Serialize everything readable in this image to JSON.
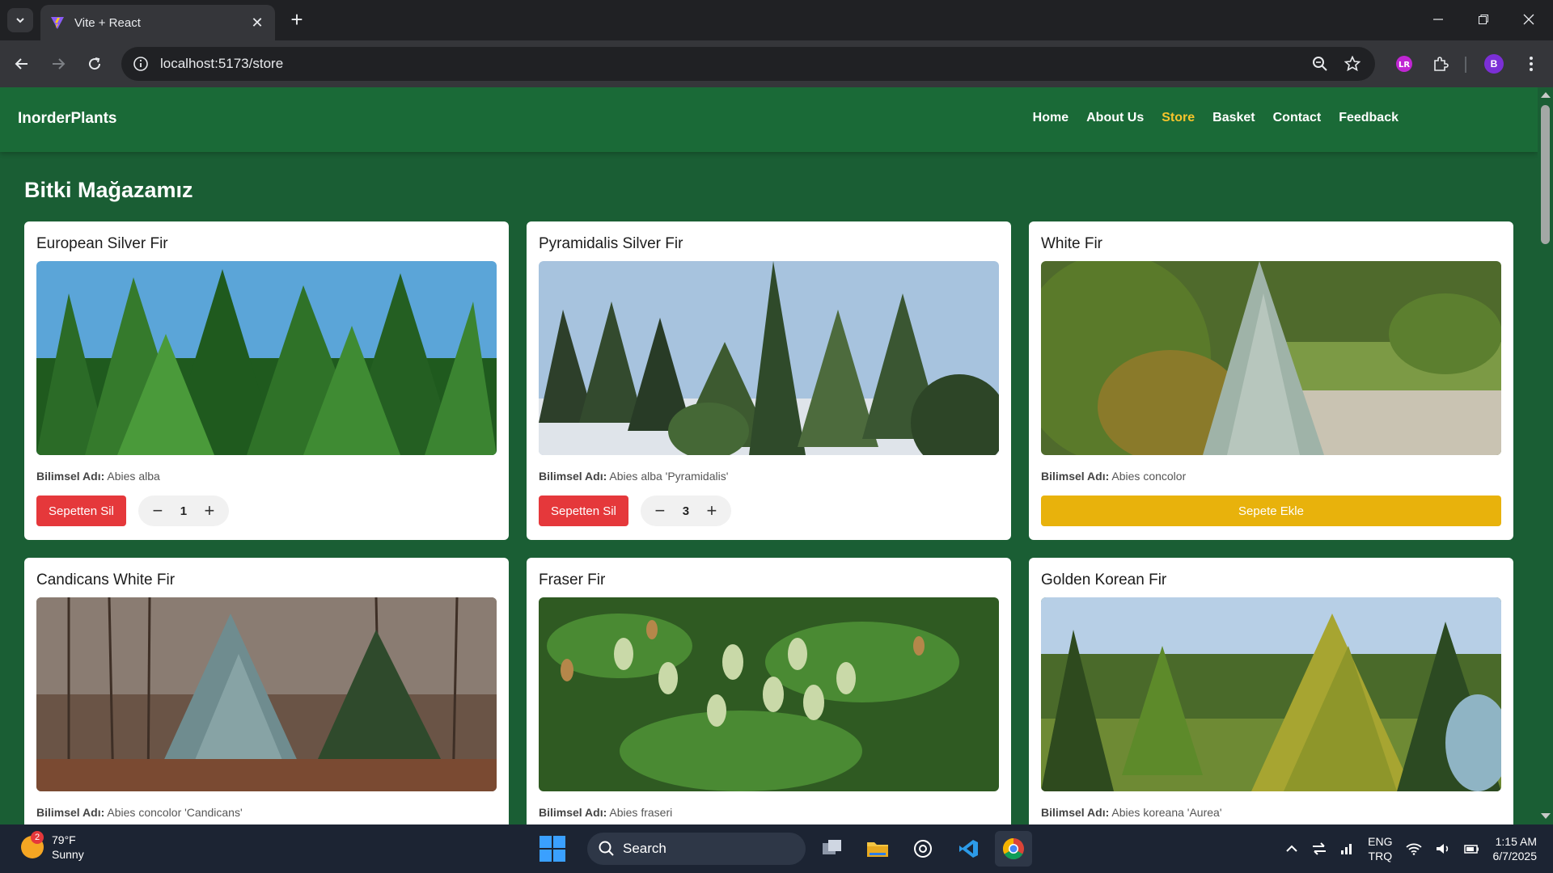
{
  "browser": {
    "tab_title": "Vite + React",
    "url": "localhost:5173/store",
    "profile_initial": "B"
  },
  "site": {
    "brand": "InorderPlants",
    "nav": [
      {
        "label": "Home",
        "active": false
      },
      {
        "label": "About Us",
        "active": false
      },
      {
        "label": "Store",
        "active": true
      },
      {
        "label": "Basket",
        "active": false
      },
      {
        "label": "Contact",
        "active": false
      },
      {
        "label": "Feedback",
        "active": false
      }
    ],
    "active_color": "#f6c42c",
    "background_color": "#1a5e34"
  },
  "store": {
    "title": "Bitki Mağazamız",
    "sci_label": "Bilimsel Adı:",
    "remove_label": "Sepetten Sil",
    "add_label": "Sepete Ekle",
    "products": [
      {
        "name": "European Silver Fir",
        "scientific": "Abies alba",
        "in_basket": true,
        "quantity": "1"
      },
      {
        "name": "Pyramidalis Silver Fir",
        "scientific": "Abies alba 'Pyramidalis'",
        "in_basket": true,
        "quantity": "3"
      },
      {
        "name": "White Fir",
        "scientific": "Abies concolor",
        "in_basket": false,
        "quantity": ""
      },
      {
        "name": "Candicans White Fir",
        "scientific": "Abies concolor 'Candicans'",
        "in_basket": false,
        "quantity": ""
      },
      {
        "name": "Fraser Fir",
        "scientific": "Abies fraseri",
        "in_basket": false,
        "quantity": ""
      },
      {
        "name": "Golden Korean Fir",
        "scientific": "Abies koreana 'Aurea'",
        "in_basket": false,
        "quantity": ""
      }
    ]
  },
  "taskbar": {
    "temperature": "79°F",
    "condition": "Sunny",
    "weather_badge": "2",
    "search_label": "Search",
    "lang_top": "ENG",
    "lang_bottom": "TRQ",
    "time": "1:15 AM",
    "date": "6/7/2025"
  }
}
